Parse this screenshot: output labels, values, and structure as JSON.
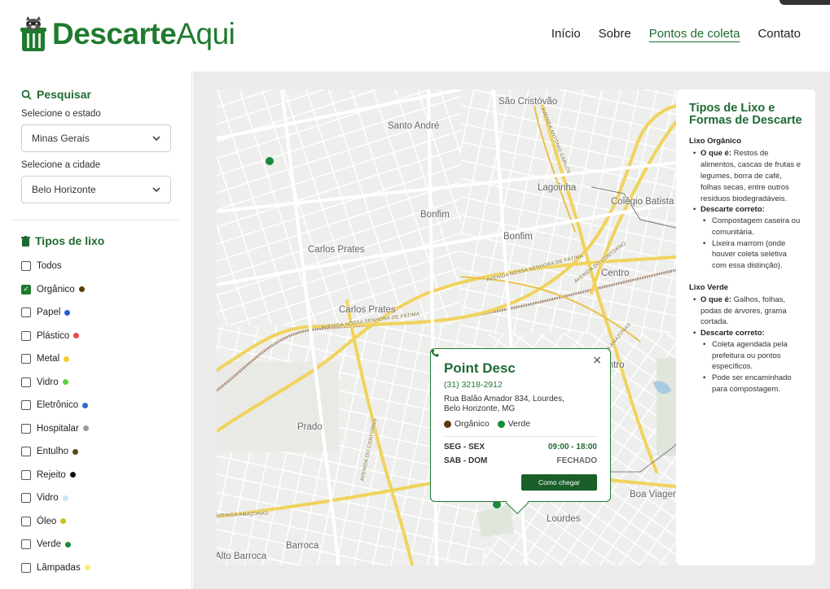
{
  "brand": {
    "bold": "Descarte",
    "light": "Aqui"
  },
  "nav": [
    {
      "label": "Início"
    },
    {
      "label": "Sobre"
    },
    {
      "label": "Pontos de coleta"
    },
    {
      "label": "Contato"
    }
  ],
  "search": {
    "title": "Pesquisar",
    "state_label": "Selecione o estado",
    "state_value": "Minas Gerais",
    "city_label": "Selecione a cidade",
    "city_value": "Belo Horizonte"
  },
  "types": {
    "title": "Tipos de lixo",
    "items": [
      {
        "label": "Todos",
        "checked": false,
        "color": ""
      },
      {
        "label": "Orgânico",
        "checked": true,
        "color": "#5a3b0a"
      },
      {
        "label": "Papel",
        "checked": false,
        "color": "#1e62d1"
      },
      {
        "label": "Plástico",
        "checked": false,
        "color": "#f04848"
      },
      {
        "label": "Metal",
        "checked": false,
        "color": "#f2cf26"
      },
      {
        "label": "Vidro",
        "checked": false,
        "color": "#5ad33c"
      },
      {
        "label": "Eletrônico",
        "checked": false,
        "color": "#2f6fc9"
      },
      {
        "label": "Hospitalar",
        "checked": false,
        "color": "#9a9a9a"
      },
      {
        "label": "Entulho",
        "checked": false,
        "color": "#5a4a14"
      },
      {
        "label": "Rejeito",
        "checked": false,
        "color": "#111111"
      },
      {
        "label": "Vidro",
        "checked": false,
        "color": "#cfe6f6"
      },
      {
        "label": "Óleo",
        "checked": false,
        "color": "#c9c31a"
      },
      {
        "label": "Verde",
        "checked": false,
        "color": "#1b8a3a"
      },
      {
        "label": "Lâmpadas",
        "checked": false,
        "color": "#f7ef6a"
      }
    ]
  },
  "map": {
    "labels": [
      "São Cristóvão",
      "Santo André",
      "Lagoinha",
      "Colégio Batista",
      "Bonfim",
      "Bonfim",
      "Carlos Prates",
      "Carlos Prates",
      "Centro",
      "Centro",
      "Prado",
      "Boa Viagem",
      "Lourdes",
      "Barroca",
      "Alto Barroca"
    ],
    "roads": [
      "AVENIDA NOSSA SENHORA DE FÁTIMA",
      "AVENIDA NOSSA SENHORA DE FÁTIMA",
      "AVENIDA DO CONTORNO",
      "AVENIDA DO CONTORNO",
      "AVENIDA AMAZONAS",
      "AVENIDA AMAZONAS",
      "AVENIDA ANTÔNIO CARLOS"
    ]
  },
  "popup": {
    "title": "Point Desc",
    "phone": "(31) 3218-2912",
    "address_line1": "Rua Balão Amador 834, Lourdes,",
    "address_line2": "Belo Horizonte, MG",
    "types": [
      {
        "label": "Orgânico",
        "color": "#5a3b0a"
      },
      {
        "label": "Verde",
        "color": "#1b8a3a"
      }
    ],
    "hours": [
      {
        "days": "SEG - SEX",
        "time": "09:00 - 18:00"
      },
      {
        "days": "SAB - DOM",
        "time": "FECHADO"
      }
    ],
    "button": "Como chegar",
    "close": "×"
  },
  "info": {
    "title": "Tipos de Lixo e Formas de Descarte",
    "sections": [
      {
        "heading": "Lixo Orgânico",
        "what_label": "O que é:",
        "what": "Restos de alimentos, cascas de frutas e legumes, borra de café, folhas secas, entre outros resíduos biodegradáveis.",
        "disposal_label": "Descarte correto:",
        "disposal": [
          "Compostagem caseira ou comunitária.",
          "Lixeira marrom (onde houver coleta seletiva com essa distinção)."
        ]
      },
      {
        "heading": "Lixo Verde",
        "what_label": "O que é:",
        "what": "Galhos, folhas, podas de árvores, grama cortada.",
        "disposal_label": "Descarte correto:",
        "disposal": [
          "Coleta agendada pela prefeitura ou pontos específicos.",
          "Pode ser encaminhado para compostagem."
        ]
      }
    ]
  },
  "colors": {
    "brand_green": "#1f7a2e",
    "marker_green": "#1b8a3a",
    "button_green": "#1a5e2a"
  }
}
